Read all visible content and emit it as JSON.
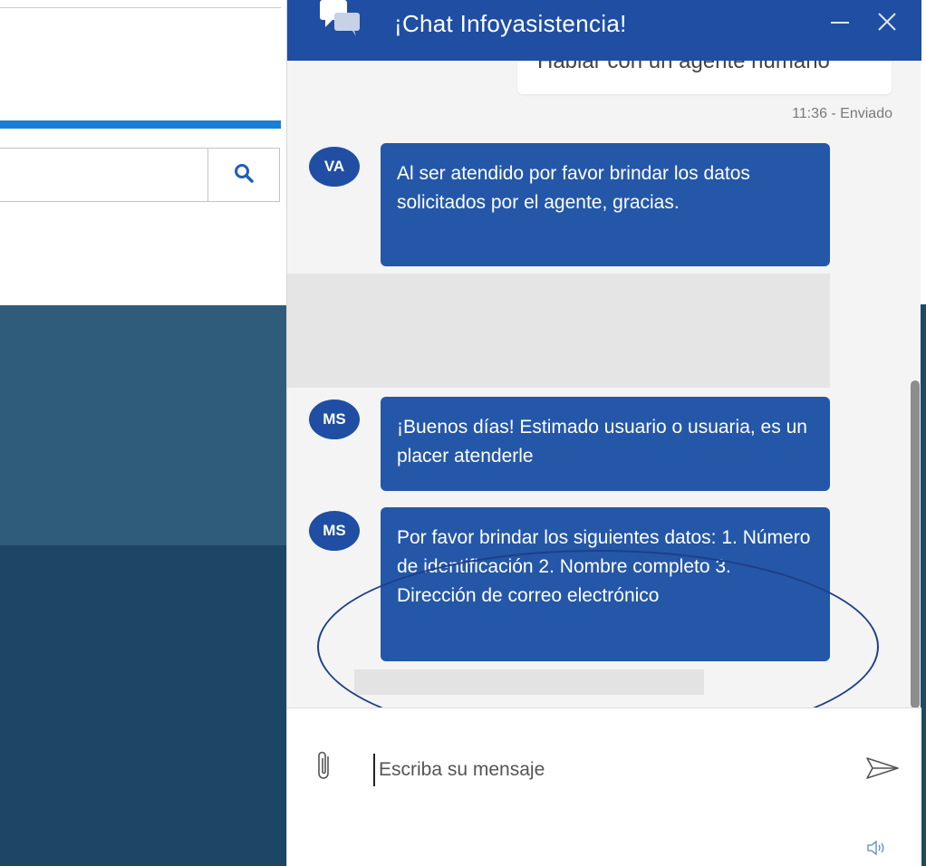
{
  "chat": {
    "title": "¡Chat Infoyasistencia!",
    "sent_message": {
      "text": "Hablar con un agente humano",
      "meta": "11:36 - Enviado"
    },
    "messages": [
      {
        "avatar": "VA",
        "text": "Al ser atendido por favor brindar los datos solicitados por el agente, gracias."
      },
      {
        "avatar": "MS",
        "text": "¡Buenos días! Estimado usuario o usuaria, es un placer atenderle"
      },
      {
        "avatar": "MS",
        "text": "Por favor brindar los siguientes datos: 1. Número de identificación 2. Nombre completo 3. Dirección de correo electrónico"
      }
    ],
    "input": {
      "placeholder": "Escriba su mensaje",
      "value": ""
    },
    "icons": {
      "logo": "chat-bubbles-icon",
      "minimize": "minimize-icon",
      "close": "close-icon",
      "attach": "paperclip-icon",
      "send": "send-icon",
      "sound": "speaker-icon"
    }
  },
  "background_page": {
    "search_icon": "search-icon"
  },
  "colors": {
    "header": "#1f4ea3",
    "bubble": "#2457a8",
    "accent_bar": "#1a7fd4",
    "bg_band_1": "#2f5c79",
    "bg_band_2": "#1c4663"
  }
}
